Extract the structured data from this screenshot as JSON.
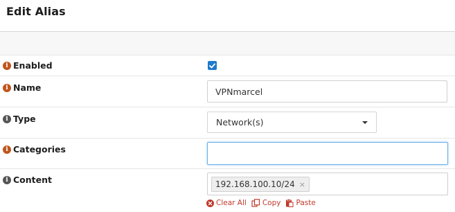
{
  "header": {
    "title": "Edit Alias"
  },
  "rows": {
    "enabled": {
      "label": "Enabled",
      "checked": true
    },
    "name": {
      "label": "Name",
      "value": "VPNmarcel"
    },
    "type": {
      "label": "Type",
      "selected": "Network(s)"
    },
    "categories": {
      "label": "Categories",
      "value": ""
    },
    "content": {
      "label": "Content",
      "tags": [
        "192.168.100.10/24"
      ],
      "tag_remove_glyph": "×"
    }
  },
  "actions": {
    "clear_all": "Clear All",
    "copy": "Copy",
    "paste": "Paste"
  },
  "icons": {
    "info": "info-circle-icon",
    "check": "check-icon",
    "caret": "caret-down-icon",
    "clear": "times-circle-icon",
    "copy": "copy-icon",
    "paste": "paste-icon"
  },
  "colors": {
    "accent_blue": "#1f7acb",
    "info_orange": "#c0551b",
    "info_gray": "#555555",
    "action_red": "#c0392b",
    "focus_border": "#66afe9"
  }
}
